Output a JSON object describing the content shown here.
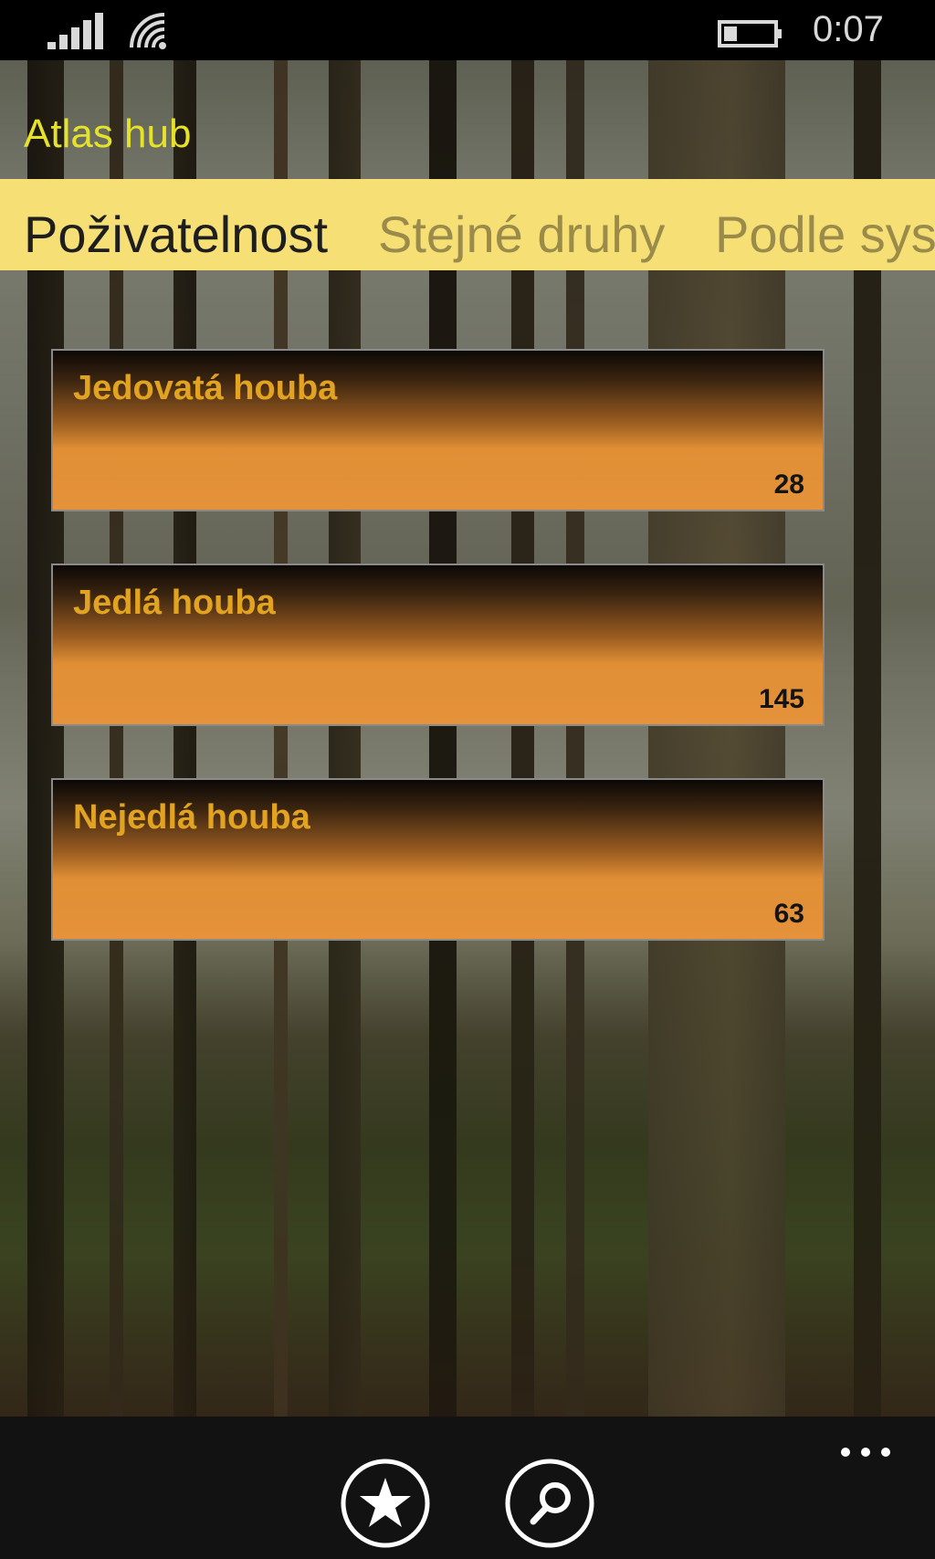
{
  "status_bar": {
    "time": "0:07",
    "icons": [
      "signal-strength-icon",
      "wifi-icon",
      "battery-icon"
    ]
  },
  "app": {
    "title": "Atlas hub"
  },
  "pivot": {
    "items": [
      {
        "label": "Poživatelnost",
        "active": true
      },
      {
        "label": "Stejné druhy",
        "active": false
      },
      {
        "label": "Podle sys",
        "active": false
      }
    ]
  },
  "categories": [
    {
      "title": "Jedovatá houba",
      "count": "28"
    },
    {
      "title": "Jedlá houba",
      "count": "145"
    },
    {
      "title": "Nejedlá houba",
      "count": "63"
    }
  ],
  "app_bar": {
    "buttons": [
      {
        "icon": "star-icon"
      },
      {
        "icon": "search-icon"
      }
    ],
    "more_icon": "more-icon"
  },
  "colors": {
    "accent_title": "#e6e22a",
    "pivot_band": "#f6df74",
    "tile_text": "#e2a320",
    "tile_bottom": "#e5923a"
  }
}
